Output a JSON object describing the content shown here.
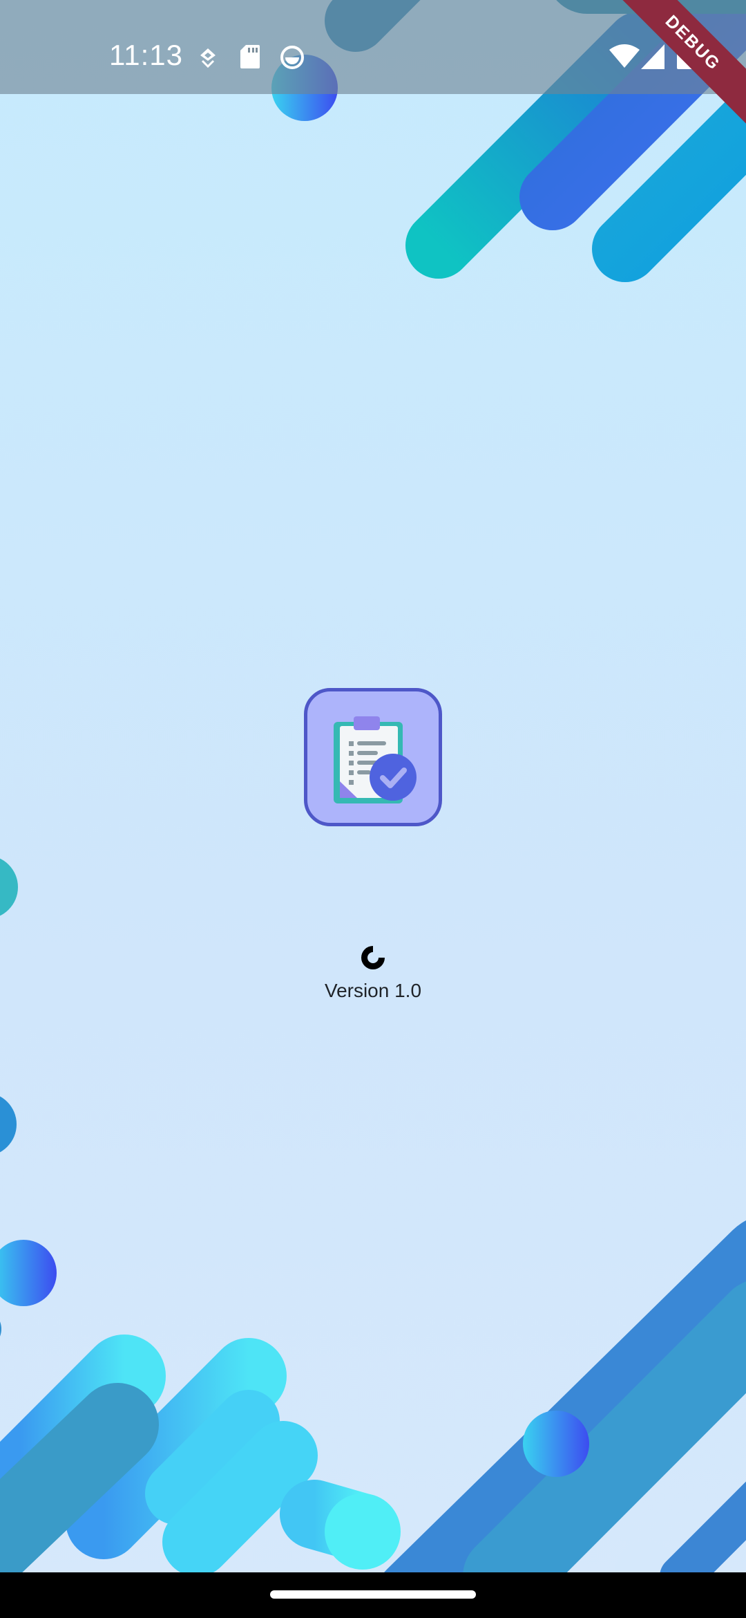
{
  "status_bar": {
    "time": "11:13",
    "left_icons": [
      "assistant-icon",
      "sd-card-icon",
      "circle-badge-icon"
    ],
    "right_icons": [
      "wifi-icon",
      "cellular-signal-icon",
      "battery-icon"
    ]
  },
  "debug_banner": "DEBUG",
  "splash": {
    "logo_icon": "clipboard-check-icon",
    "loading_icon": "loading-spinner-icon",
    "version": "Version 1.0"
  },
  "colors": {
    "background_top": "#c6ebfd",
    "background_bottom": "#d6e8fb",
    "logo_fill": "#adb4fb",
    "logo_border": "#4e57c8",
    "accent_blue": "#3b5bdb",
    "teal": "#35b9b3",
    "debug_banner": "#8e2a3f"
  }
}
